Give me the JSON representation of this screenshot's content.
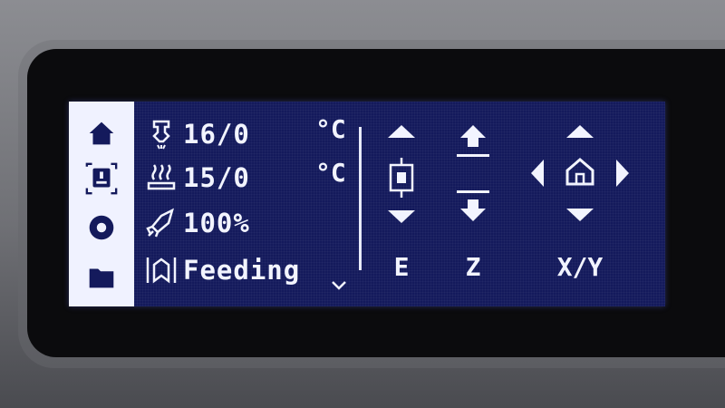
{
  "status": {
    "nozzle": {
      "icon": "nozzle-icon",
      "value": "16/0",
      "unit": "°C"
    },
    "bed": {
      "icon": "heated-bed-icon",
      "value": "15/0",
      "unit": "°C"
    },
    "speed": {
      "icon": "speed-rocket-icon",
      "value": "100%"
    },
    "state": {
      "icon": "feeding-icon",
      "value": "Feeding"
    }
  },
  "sidebar": {
    "items": [
      {
        "icon": "home-icon",
        "selected": false
      },
      {
        "icon": "printer-control-icon",
        "selected": true
      },
      {
        "icon": "settings-gear-icon",
        "selected": false
      },
      {
        "icon": "folder-icon",
        "selected": false
      }
    ]
  },
  "controls": {
    "e_label": "E",
    "z_label": "Z",
    "xy_label": "X/Y"
  },
  "colors": {
    "screen_bg": "#141a5c",
    "foreground": "#f2f4ff",
    "sidebar_bg": "#f0f2ff",
    "sidebar_icon": "#141a5c"
  }
}
